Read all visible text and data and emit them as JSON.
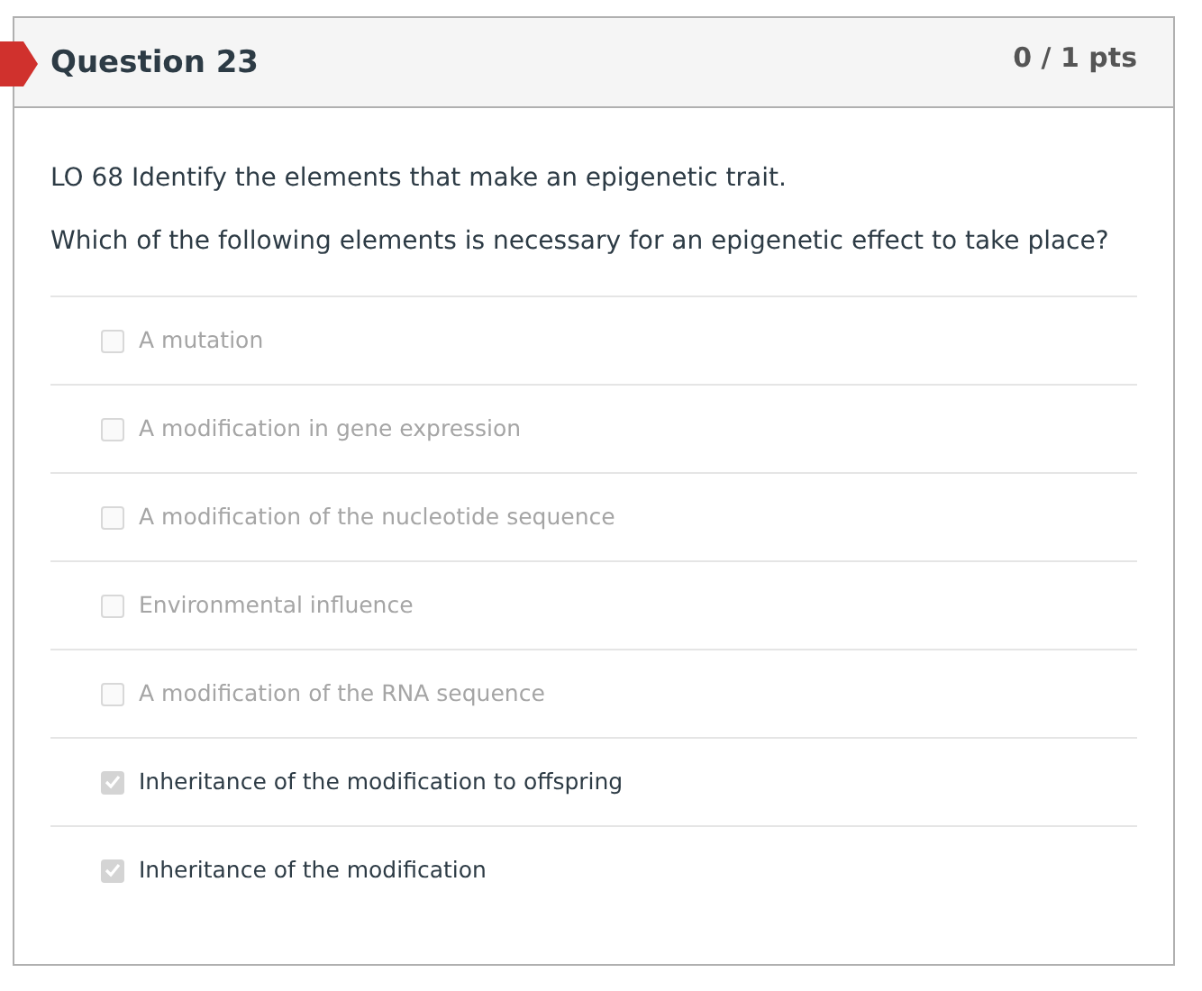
{
  "question": {
    "title": "Question 23",
    "points": "0 / 1 pts",
    "flagged": true
  },
  "prompt": [
    "LO 68 Identify the elements that make an epigenetic trait.",
    "Which of the following elements is necessary for an epigenetic effect to take place?"
  ],
  "options": [
    {
      "label": "A mutation",
      "checked": false
    },
    {
      "label": "A modification in gene expression",
      "checked": false
    },
    {
      "label": "A modification of the nucleotide sequence",
      "checked": false
    },
    {
      "label": "Environmental influence",
      "checked": false
    },
    {
      "label": "A modification of the RNA sequence",
      "checked": false
    },
    {
      "label": "Inheritance of the modification to offspring",
      "checked": true
    },
    {
      "label": "Inheritance of the modification",
      "checked": true
    }
  ]
}
